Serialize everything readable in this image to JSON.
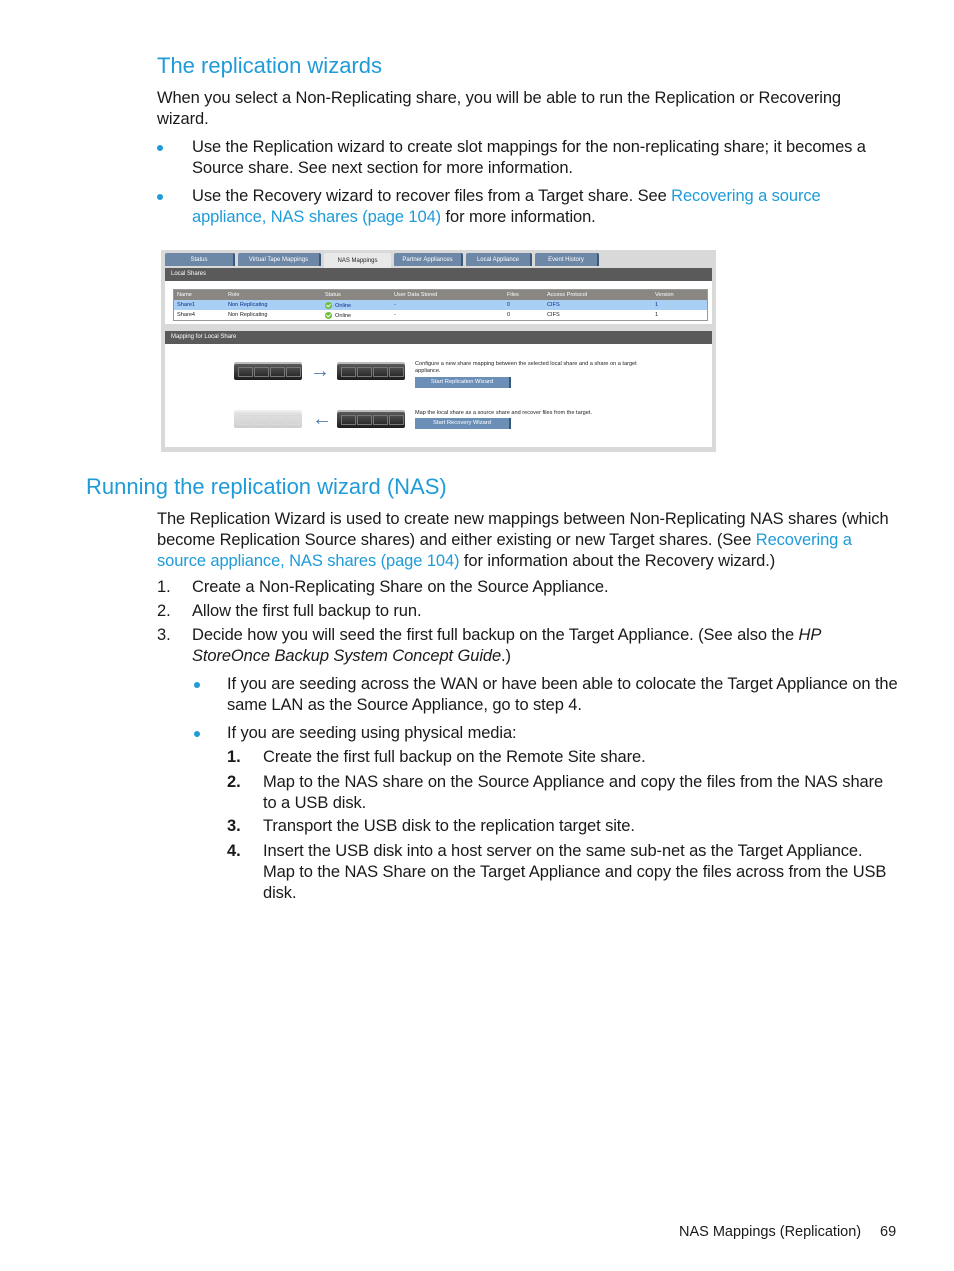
{
  "section1": {
    "title": "The replication wizards",
    "intro": "When you select a Non-Replicating share, you will be able to run the Replication or Recovering wizard.",
    "bullets": [
      {
        "text": "Use the Replication wizard to create slot mappings for the non-replicating share; it becomes a Source share. See next section for more information."
      },
      {
        "text_before": "Use the Recovery wizard to recover files from a Target share. See ",
        "link": "Recovering a source appliance, NAS shares (page 104)",
        "text_after": " for more information."
      }
    ]
  },
  "screenshot": {
    "tabs": [
      "Status",
      "Virtual Tape Mappings",
      "NAS Mappings",
      "Partner Appliances",
      "Local Appliance",
      "Event History"
    ],
    "active_tab": "NAS Mappings",
    "local_shares": {
      "header": "Local Shares",
      "columns": [
        "Name",
        "Role",
        "Status",
        "User Data Stored",
        "Files",
        "Access Protocol",
        "Version"
      ],
      "rows": [
        {
          "name": "Share1",
          "role": "Non Replicating",
          "status": "Online",
          "user_data": "-",
          "files": "0",
          "protocol": "CIFS",
          "version": "1",
          "selected": true
        },
        {
          "name": "Share4",
          "role": "Non Replicating",
          "status": "Online",
          "user_data": "-",
          "files": "0",
          "protocol": "CIFS",
          "version": "1",
          "selected": false
        }
      ]
    },
    "mapping": {
      "header": "Mapping for Local Share",
      "replication_text": "Configure a new share mapping between the selected local share and a share on a target appliance.",
      "replication_button": "Start Replication Wizard",
      "recovery_text": "Map the local share as a source share and recover files from the target.",
      "recovery_button": "Start Recovery Wizard"
    }
  },
  "section2": {
    "title": "Running the replication wizard (NAS)",
    "intro_before": "The Replication Wizard is used to create new mappings between Non-Replicating NAS shares (which become Replication Source shares) and either existing or new Target shares. (See ",
    "intro_link": "Recovering a source appliance, NAS shares (page 104)",
    "intro_after": " for information about the Recovery wizard.)",
    "steps": [
      {
        "num": "1.",
        "text": "Create a Non-Replicating Share on the Source Appliance."
      },
      {
        "num": "2.",
        "text": "Allow the first full backup to run."
      },
      {
        "num": "3.",
        "text_before": "Decide how you will seed the first full backup on the Target Appliance. (See also the ",
        "italic": "HP StoreOnce Backup System Concept Guide",
        "text_after": ".)"
      }
    ],
    "sub_bullets": [
      {
        "text": "If you are seeding across the WAN or have been able to colocate the Target Appliance on the same LAN as the Source Appliance, go to step 4."
      },
      {
        "text": "If you are seeding using physical media:"
      }
    ],
    "sub_steps": [
      {
        "num": "1.",
        "text": "Create the first full backup on the Remote Site share."
      },
      {
        "num": "2.",
        "text": "Map to the NAS share on the Source Appliance and copy the files from the NAS share to a USB disk."
      },
      {
        "num": "3.",
        "text": "Transport the USB disk to the replication target site."
      },
      {
        "num": "4.",
        "text": "Insert the USB disk into a host server on the same sub-net as the Target Appliance. Map to the NAS Share on the Target Appliance and copy the files across from the USB disk."
      }
    ]
  },
  "footer": {
    "section": "NAS Mappings (Replication)",
    "page": "69"
  }
}
